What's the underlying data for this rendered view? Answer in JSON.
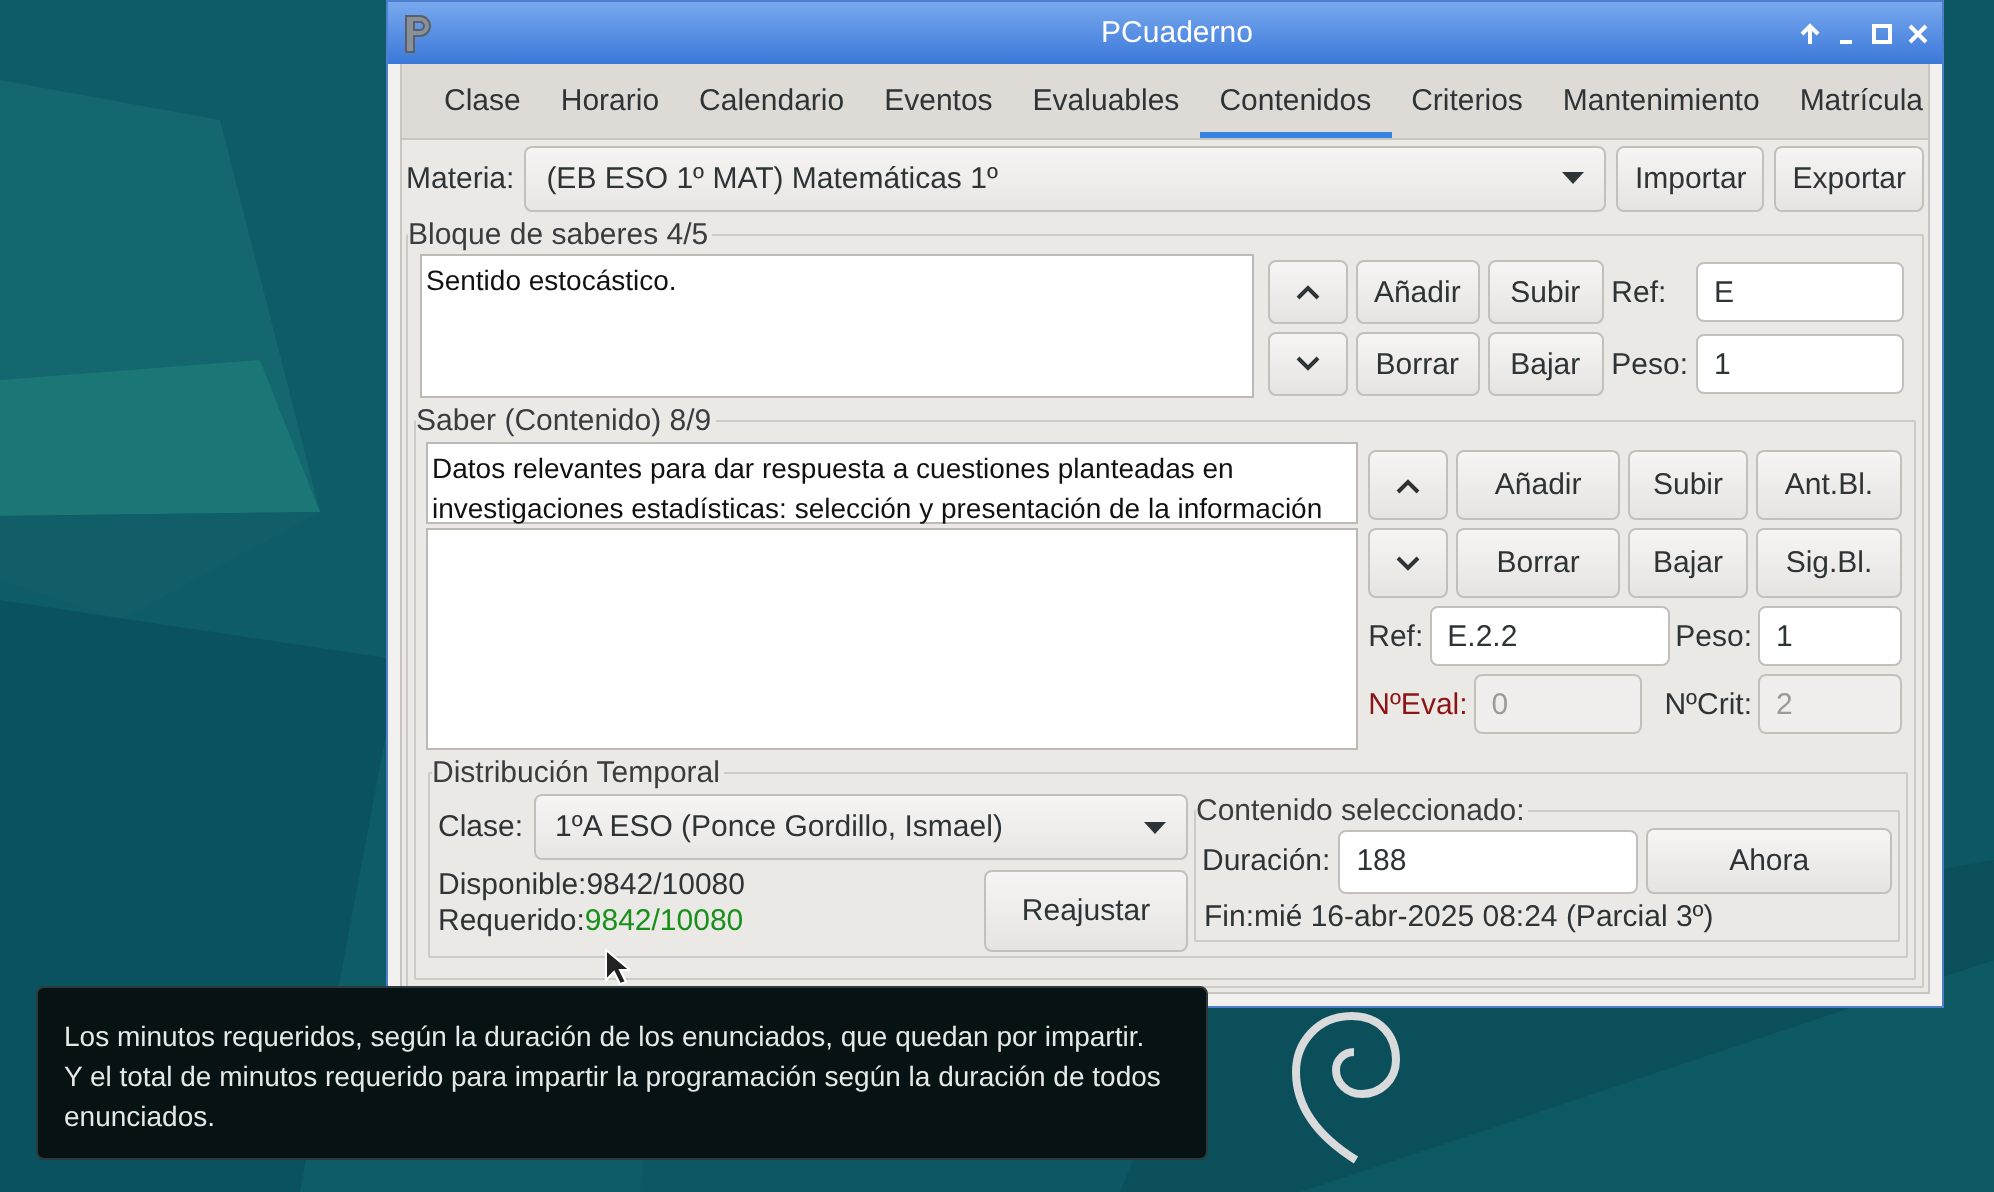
{
  "window": {
    "title": "PCuaderno"
  },
  "tabs": [
    {
      "label": "Clase",
      "selected": false
    },
    {
      "label": "Horario",
      "selected": false
    },
    {
      "label": "Calendario",
      "selected": false
    },
    {
      "label": "Eventos",
      "selected": false
    },
    {
      "label": "Evaluables",
      "selected": false
    },
    {
      "label": "Contenidos",
      "selected": true
    },
    {
      "label": "Criterios",
      "selected": false
    },
    {
      "label": "Mantenimiento",
      "selected": false
    },
    {
      "label": "Matrícula",
      "selected": false
    }
  ],
  "materia": {
    "label": "Materia:",
    "value": "(EB ESO 1º MAT) Matemáticas 1º",
    "buttons": [
      "Importar",
      "Exportar"
    ]
  },
  "bloque": {
    "title": "Bloque de saberes 4/5",
    "text": "Sentido estocástico.",
    "buttons": [
      "Añadir",
      "Subir",
      "Borrar",
      "Bajar"
    ],
    "fields": [
      {
        "label": "Ref:",
        "value": "E",
        "disabled": false,
        "warning": false
      },
      {
        "label": "Peso:",
        "value": "1",
        "disabled": false,
        "warning": false
      }
    ]
  },
  "saber": {
    "title": "Saber (Contenido) 8/9",
    "text": "Datos relevantes para dar respuesta a cuestiones planteadas en investigaciones estadísticas: selección y presentación de la información",
    "buttons": [
      "Añadir",
      "Subir",
      "Ant.Bl.",
      "Borrar",
      "Bajar",
      "Sig.Bl."
    ],
    "fields": [
      {
        "label": "Ref:",
        "value": "E.2.2",
        "disabled": false,
        "warning": false
      },
      {
        "label": "Peso:",
        "value": "1",
        "disabled": false,
        "warning": false
      },
      {
        "label": "NºEval:",
        "value": "0",
        "disabled": true,
        "warning": true
      },
      {
        "label": "NºCrit:",
        "value": "2",
        "disabled": true,
        "warning": false
      }
    ]
  },
  "distribucion": {
    "title": "Distribución Temporal",
    "clase": {
      "label": "Clase:",
      "value": "1ºA ESO (Ponce Gordillo, Ismael)"
    },
    "counts": [
      {
        "label": "Disponible:",
        "value": "9842/10080",
        "highlighted": false
      },
      {
        "label": "Requerido:",
        "value": "9842/10080",
        "highlighted": true
      }
    ],
    "button": "Reajustar",
    "contenido": {
      "title": "Contenido seleccionado:",
      "label": "Duración:",
      "value": "188",
      "button": "Ahora",
      "fin": "Fin:mié 16-abr-2025 08:24 (Parcial 3º)"
    }
  },
  "tooltip": {
    "paragraphs": [
      "Los minutos requeridos, según la duración de los enunciados, que quedan por impartir.",
      "Y el total de minutos requerido para impartir la programación según la duración de todos enunciados."
    ]
  }
}
